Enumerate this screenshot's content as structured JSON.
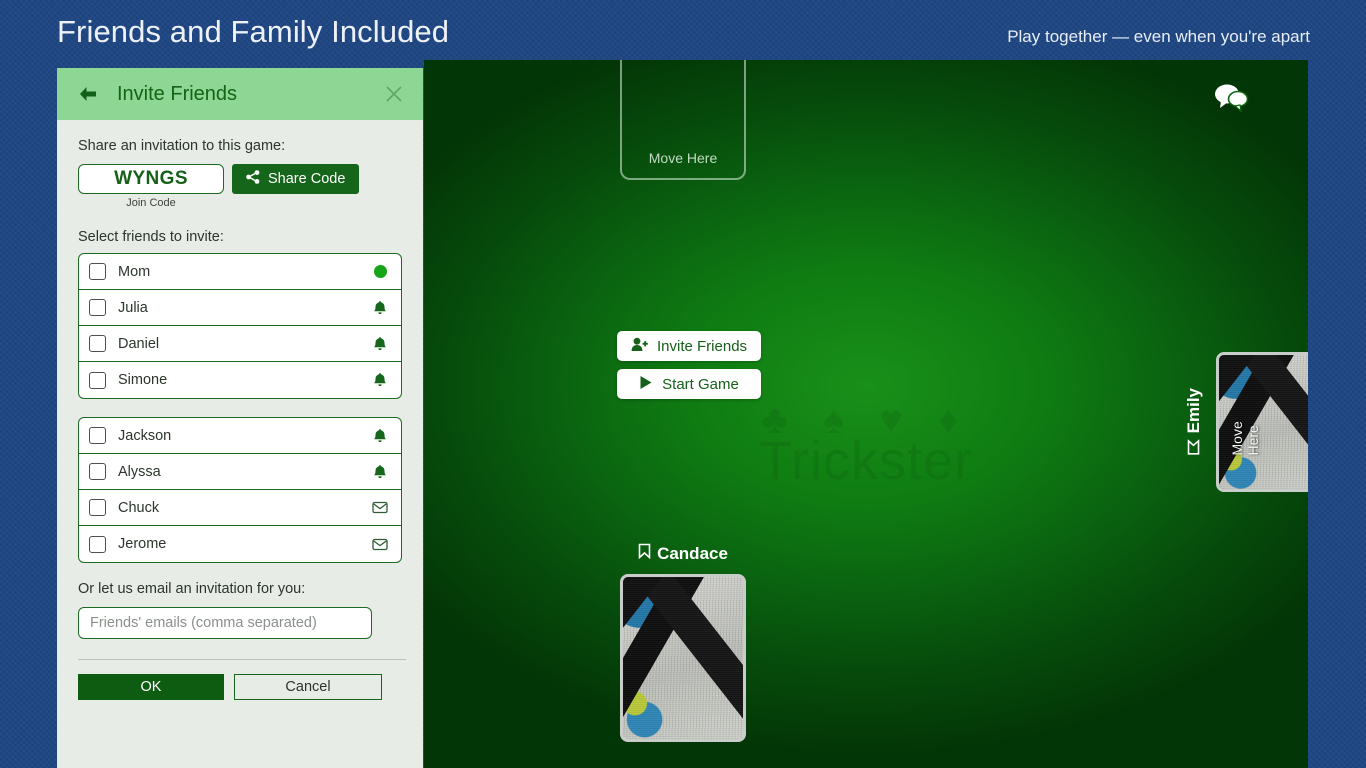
{
  "banner": {
    "title": "Friends and Family Included",
    "tagline": "Play together — even when you're apart"
  },
  "dialog": {
    "title": "Invite Friends",
    "back_icon": "arrow-left-icon",
    "close_icon": "close-icon",
    "share_label": "Share an invitation to this game:",
    "join_code": "WYNGS",
    "join_code_caption": "Join Code",
    "share_button": "Share Code",
    "select_label": "Select friends to invite:",
    "friend_groups": [
      {
        "rows": [
          {
            "name": "Mom",
            "status": "online",
            "checked": false
          },
          {
            "name": "Julia",
            "status": "notify",
            "checked": false
          },
          {
            "name": "Daniel",
            "status": "notify",
            "checked": false
          },
          {
            "name": "Simone",
            "status": "notify",
            "checked": false
          }
        ]
      },
      {
        "rows": [
          {
            "name": "Jackson",
            "status": "notify",
            "checked": false
          },
          {
            "name": "Alyssa",
            "status": "notify",
            "checked": false
          },
          {
            "name": "Chuck",
            "status": "email",
            "checked": false
          },
          {
            "name": "Jerome",
            "status": "email",
            "checked": false
          }
        ]
      }
    ],
    "email_label": "Or let us email an invitation for you:",
    "email_placeholder": "Friends' emails (comma separated)",
    "email_value": "",
    "ok_label": "OK",
    "cancel_label": "Cancel"
  },
  "table": {
    "watermark_suits": "♣ ♠ ♥ ♦",
    "watermark_word": "Trickster",
    "chat_icon": "chat-bubbles-icon",
    "slot_top_label": "Move Here",
    "slot_right_label": "Move Here",
    "invite_button": "Invite Friends",
    "invite_icon": "person-add-icon",
    "start_button": "Start Game",
    "start_icon": "play-icon",
    "players": [
      {
        "name": "Candace",
        "position": "bottom",
        "icon": "bookmark-icon"
      },
      {
        "name": "Emily",
        "position": "right",
        "icon": "bookmark-icon"
      }
    ]
  },
  "colors": {
    "banner_bg": "#1d4582",
    "dialog_bg": "#e7ece6",
    "dialog_header": "#8ed694",
    "accent_green": "#15651a",
    "online_dot": "#17a517",
    "table_green": "#0f7c12"
  }
}
